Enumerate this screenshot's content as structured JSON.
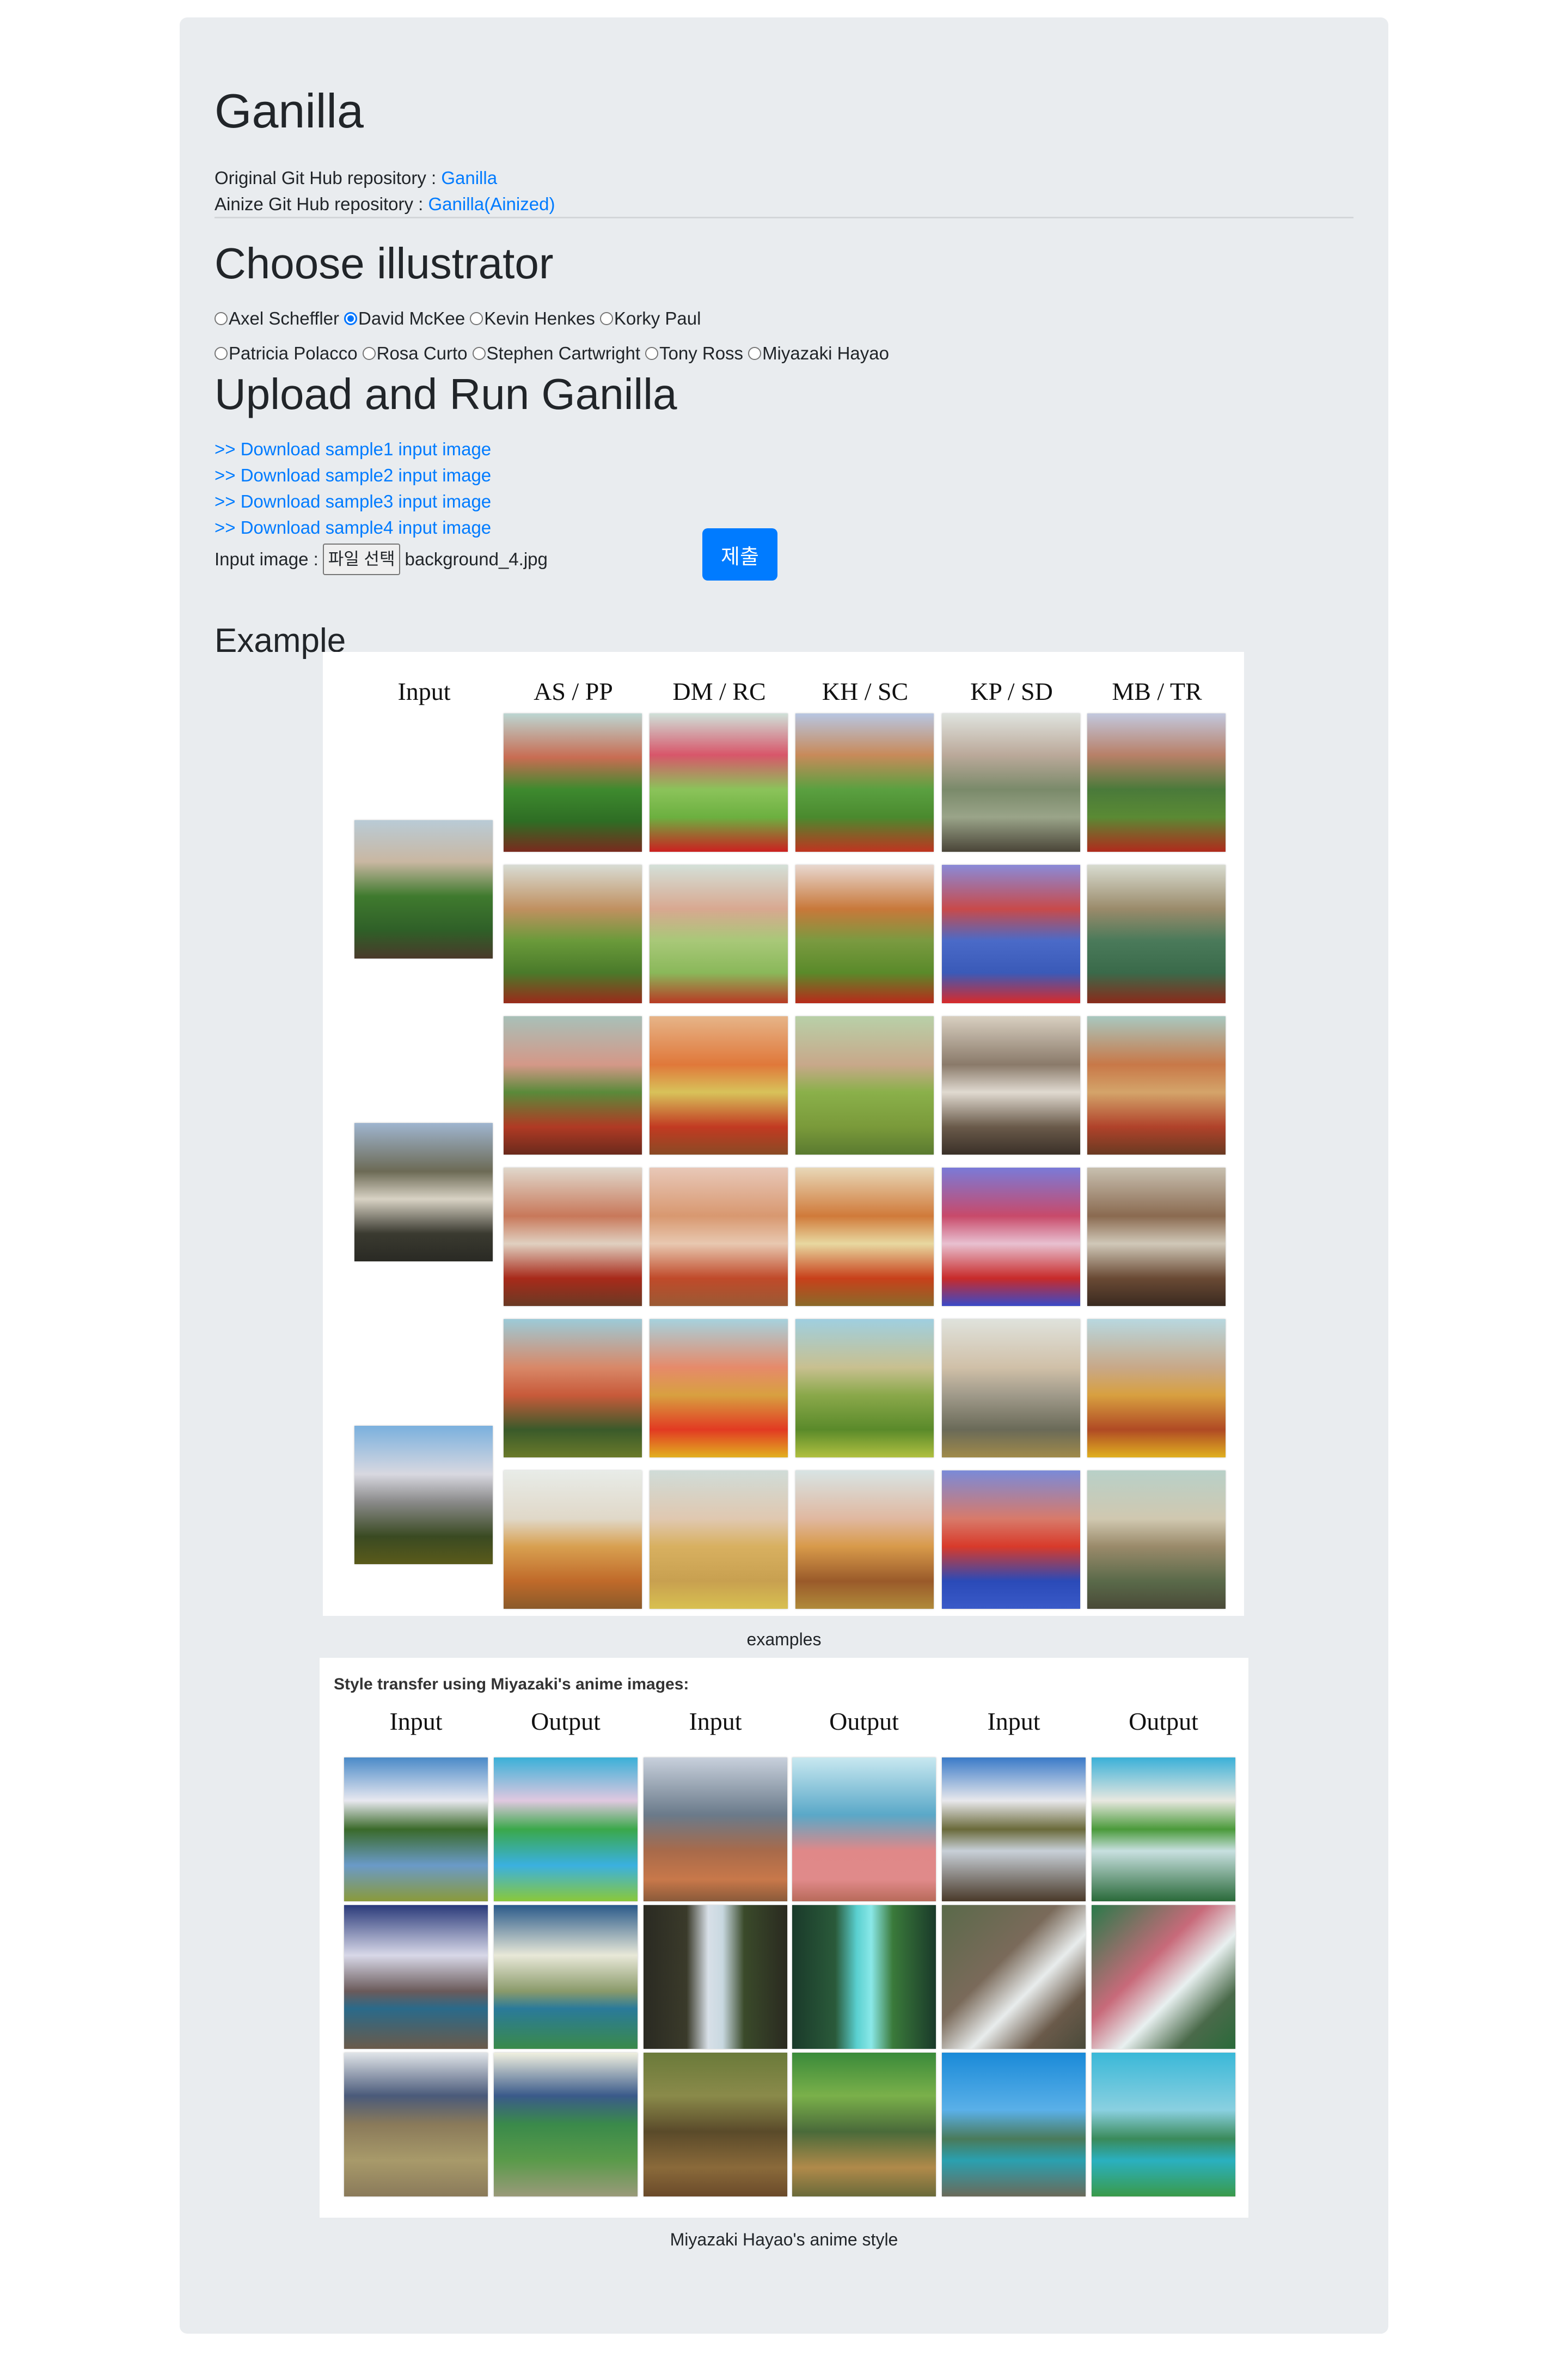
{
  "header": {
    "title": "Ganilla",
    "original_repo_label": "Original Git Hub repository : ",
    "original_repo_link": "Ganilla",
    "ainize_repo_label": "Ainize Git Hub repository : ",
    "ainize_repo_link": "Ganilla(Ainized)"
  },
  "illustrator": {
    "heading": "Choose illustrator",
    "selected": "David McKee",
    "options_row1": [
      "Axel Scheffler",
      "David McKee",
      "Kevin Henkes",
      "Korky Paul"
    ],
    "options_row2": [
      "Patricia Polacco",
      "Rosa Curto",
      "Stephen Cartwright",
      "Tony Ross",
      "Miyazaki Hayao"
    ]
  },
  "upload": {
    "heading": "Upload and Run Ganilla",
    "downloads": [
      ">> Download sample1 input image",
      ">> Download sample2 input image",
      ">> Download sample3 input image",
      ">> Download sample4 input image"
    ],
    "input_label": "Input image : ",
    "file_button": "파일 선택",
    "file_name": "background_4.jpg",
    "submit": "제출"
  },
  "example": {
    "heading": "Example",
    "figure1": {
      "column_labels": [
        "Input",
        "AS / PP",
        "DM / RC",
        "KH / SC",
        "KP / SD",
        "MB / TR"
      ],
      "caption": "examples"
    },
    "figure2": {
      "title": "Style transfer using Miyazaki's anime images:",
      "column_labels": [
        "Input",
        "Output",
        "Input",
        "Output",
        "Input",
        "Output"
      ],
      "caption": "Miyazaki Hayao's anime style"
    }
  },
  "colors": {
    "jumbotron_bg": "#e9ecef",
    "link": "#007bff",
    "primary_button": "#007bff",
    "radio_checked": "#0075ff"
  }
}
